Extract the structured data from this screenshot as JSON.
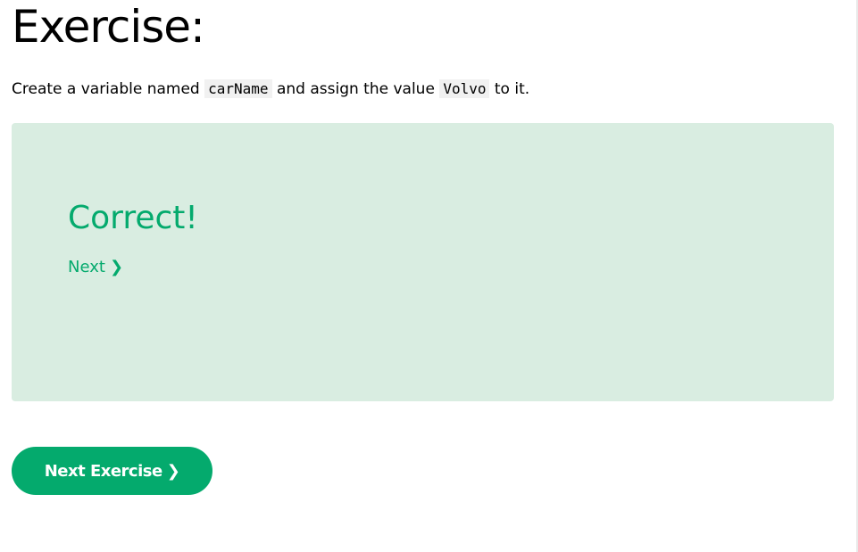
{
  "page": {
    "title": "Exercise:"
  },
  "instructions": {
    "prefix": "Create a variable named",
    "code1": "carName",
    "middle": "and assign the value",
    "code2": "Volvo",
    "suffix": "to it."
  },
  "result": {
    "title": "Correct!",
    "next_label": "Next",
    "next_icon": "chevron-right-icon"
  },
  "actions": {
    "next_exercise_label": "Next Exercise",
    "next_exercise_icon": "chevron-right-icon"
  },
  "colors": {
    "accent": "#04aa6d",
    "panel_background": "#d9ede1",
    "code_background": "#f1f1f1"
  }
}
